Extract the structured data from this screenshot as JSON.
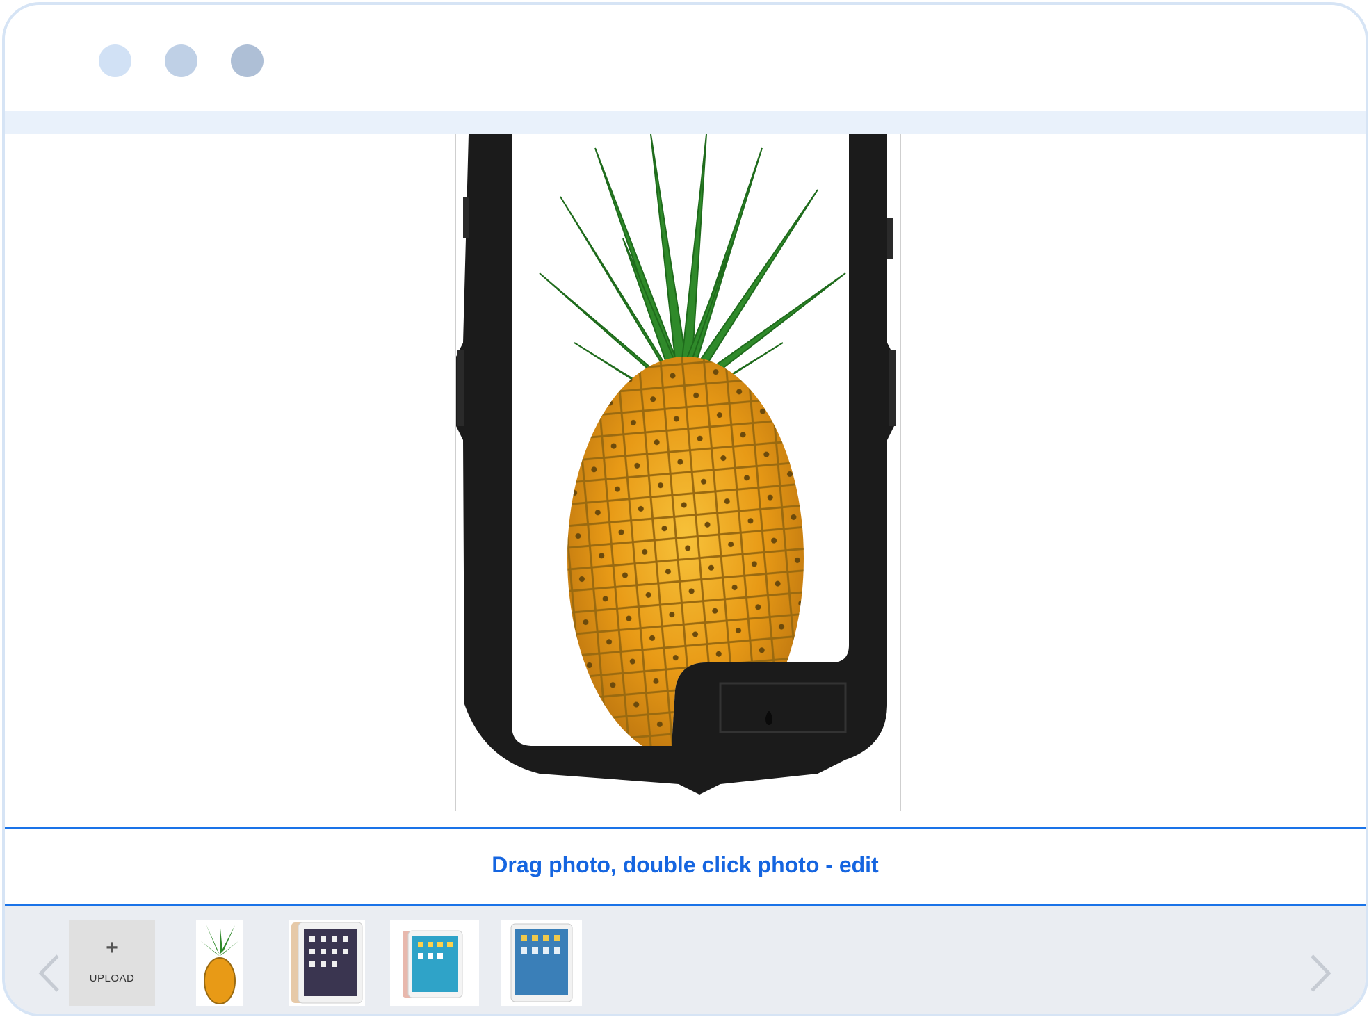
{
  "hint": {
    "text": "Drag photo, double click photo - edit"
  },
  "upload": {
    "icon": "plus-icon",
    "label": "UPLOAD"
  },
  "thumbnails": [
    "pineapple",
    "ipad-gold",
    "ipad-rose-gold",
    "ipad-silver"
  ],
  "colors": {
    "accent": "#1565e0",
    "divider": "#1a73e8",
    "tray": "#eaedf2"
  }
}
